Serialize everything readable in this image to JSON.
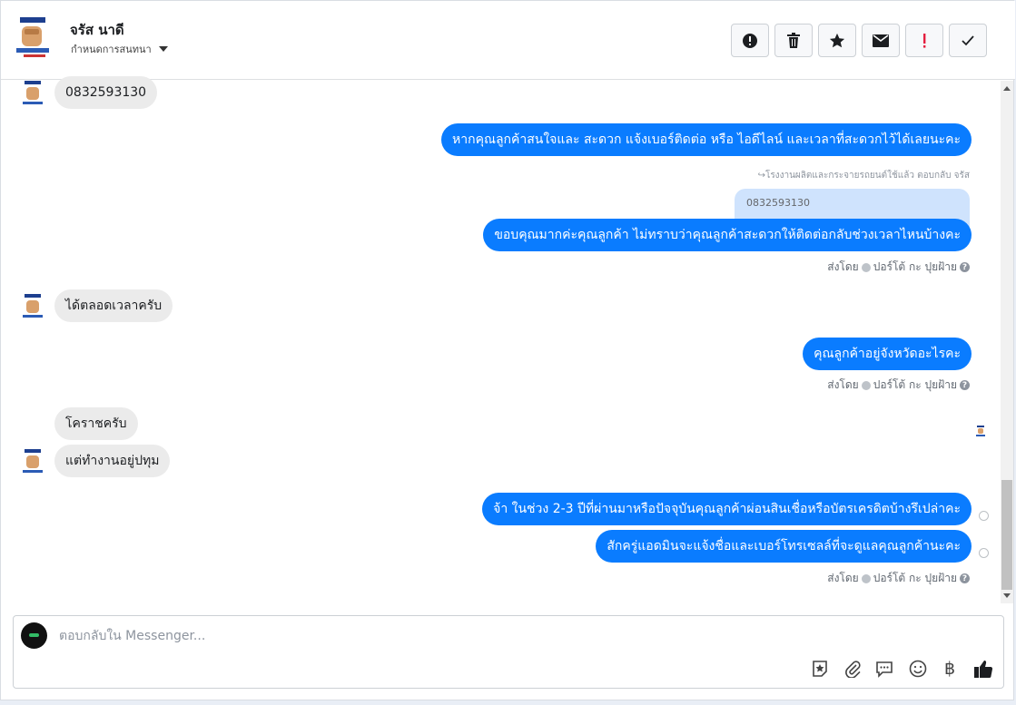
{
  "header": {
    "contact_name": "จรัส นาดี",
    "assign_label": "กำหนดการสนทนา",
    "actions": [
      {
        "name": "report",
        "icon": "exclamation-circle-icon"
      },
      {
        "name": "delete",
        "icon": "trash-icon"
      },
      {
        "name": "star",
        "icon": "star-icon"
      },
      {
        "name": "mark-unread",
        "icon": "envelope-icon"
      },
      {
        "name": "flag-important",
        "icon": "exclamation-icon"
      },
      {
        "name": "mark-done",
        "icon": "check-icon"
      }
    ]
  },
  "messages": [
    {
      "direction": "in",
      "text": "0832593130"
    },
    {
      "direction": "out",
      "text": "หากคุณลูกค้าสนใจและ สะดวก แจ้งเบอร์ติดต่อ หรือ ไอดีไลน์ และเวลาที่สะดวกไว้ได้เลยนะคะ"
    },
    {
      "direction": "out",
      "reply_meta": "↪โรงงานผลิตและกระจายรถยนต์ใช้แล้ว ตอบกลับ จรัส",
      "quoted": "0832593130",
      "text": "ขอบคุณมากค่ะคุณลูกค้า  ไม่ทราบว่าคุณลูกค้าสะดวกให้ติดต่อกลับช่วงเวลาไหนบ้างคะ"
    },
    {
      "direction": "in",
      "text": "ได้ตลอดเวลาครับ"
    },
    {
      "direction": "out",
      "text": "คุณลูกค้าอยู่จังหวัดอะไรคะ"
    },
    {
      "direction": "in",
      "text": "โคราชครับ"
    },
    {
      "direction": "in",
      "text": "แต่ทำงานอยู่ปทุม"
    },
    {
      "direction": "out",
      "text": "จ้า ในช่วง 2-3 ปีที่ผ่านมาหรือปัจจุบันคุณลูกค้าผ่อนสินเชื่อหรือบัตรเครดิตบ้างรึเปล่าคะ"
    },
    {
      "direction": "out",
      "text": "สักครู่แอดมินจะแจ้งชื่อและเบอร์โทรเซลล์ที่จะดูแลคุณลูกค้านะคะ"
    }
  ],
  "sent_by": {
    "prefix": "ส่งโดย",
    "name": "ปอร์โต้ กะ ปุยฝ้าย",
    "help": "?"
  },
  "composer": {
    "placeholder": "ตอบกลับใน Messenger...",
    "tools": [
      "sticker-icon",
      "paperclip-icon",
      "saved-replies-icon",
      "emoji-icon",
      "baht-icon",
      "like-icon"
    ],
    "baht_symbol": "฿"
  },
  "colors": {
    "outgoing_bubble": "#0a7cff",
    "incoming_bubble": "#ebebeb",
    "flag_red": "#e41e3f"
  }
}
